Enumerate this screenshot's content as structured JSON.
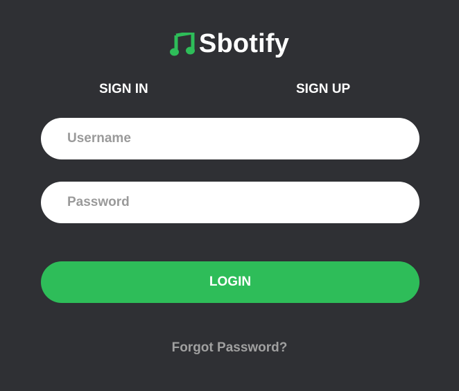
{
  "brand": {
    "name": "Sbotify",
    "icon": "music-note-icon",
    "accent_color": "#2ebd59"
  },
  "tabs": [
    {
      "label": "SIGN IN"
    },
    {
      "label": "SIGN UP"
    }
  ],
  "form": {
    "username": {
      "value": "",
      "placeholder": "Username"
    },
    "password": {
      "value": "",
      "placeholder": "Password"
    },
    "login_label": "LOGIN",
    "forgot_label": "Forgot Password?"
  },
  "colors": {
    "background": "#2f3034",
    "input_background": "#ffffff",
    "placeholder": "#9a9a9a",
    "link": "#a0a0a0"
  }
}
